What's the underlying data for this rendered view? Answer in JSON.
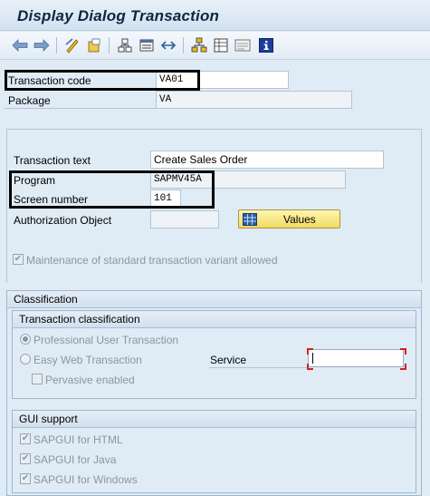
{
  "window": {
    "title": "Display Dialog Transaction"
  },
  "toolbar": {
    "icons": [
      "back-arrow-icon",
      "forward-arrow-icon",
      "display-change-icon",
      "other-object-icon",
      "object-list-icon",
      "display-object-icon",
      "navigation-icon",
      "hierarchy-icon",
      "where-used-icon",
      "layout-icon",
      "info-icon"
    ]
  },
  "header": {
    "transaction_code_label": "Transaction code",
    "transaction_code_value": "VA01",
    "package_label": "Package",
    "package_value": "VA"
  },
  "details": {
    "transaction_text_label": "Transaction text",
    "transaction_text_value": "Create Sales Order",
    "program_label": "Program",
    "program_value": "SAPMV45A",
    "screen_number_label": "Screen number",
    "screen_number_value": "101",
    "auth_object_label": "Authorization Object",
    "auth_object_value": "",
    "values_button_label": "Values",
    "maintenance_label": "Maintenance of standard transaction variant allowed",
    "maintenance_checked": true
  },
  "classification": {
    "title": "Classification",
    "transaction_classification": {
      "title": "Transaction classification",
      "professional_label": "Professional User Transaction",
      "easy_web_label": "Easy Web Transaction",
      "pervasive_label": "Pervasive enabled",
      "service_label": "Service",
      "service_value": "",
      "selected": "professional"
    },
    "gui_support": {
      "title": "GUI support",
      "html_label": "SAPGUI for HTML",
      "java_label": "SAPGUI for Java",
      "windows_label": "SAPGUI for Windows",
      "html_checked": true,
      "java_checked": true,
      "windows_checked": true
    }
  },
  "colors": {
    "background": "#dfebf5",
    "highlight_border": "#000000",
    "values_button": "#f2db63",
    "required_marker": "#d32020",
    "info_icon": "#1a3f9c"
  }
}
